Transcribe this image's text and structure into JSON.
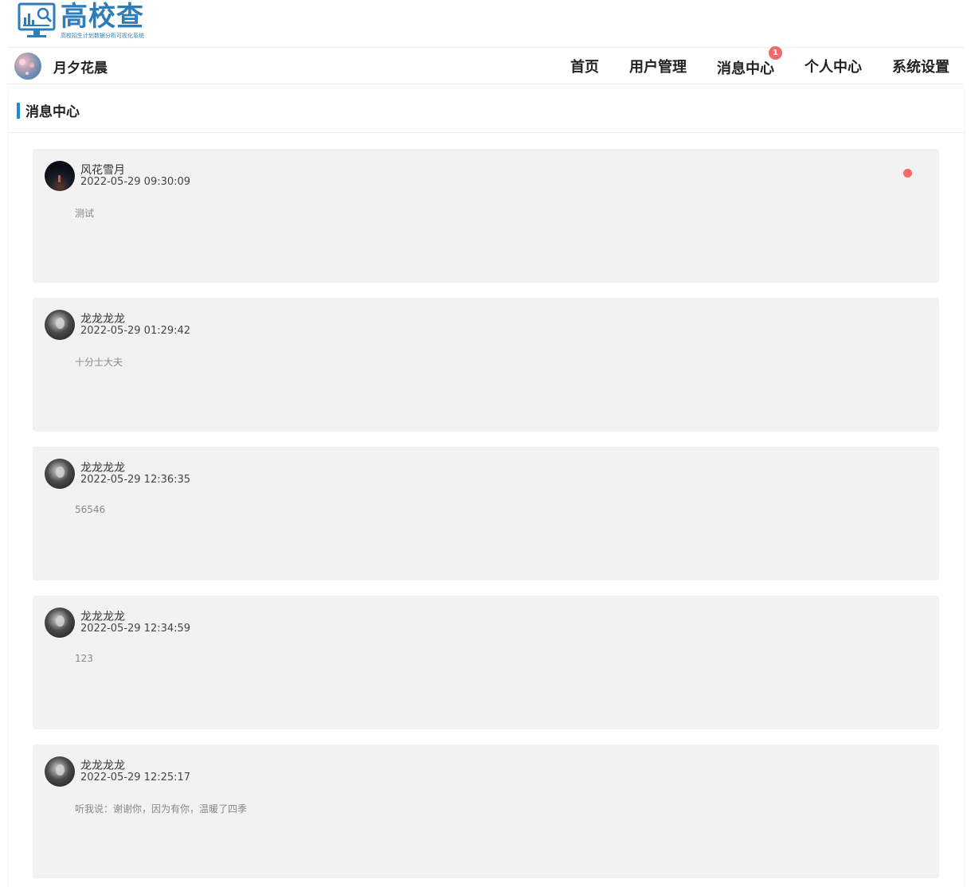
{
  "logo": {
    "title": "高校查",
    "subtitle": "高校招生计划数据分析可视化系统",
    "icon": "monitor-chart-search-icon",
    "color": "#2f7db8"
  },
  "user": {
    "name": "月夕花晨",
    "avatar": "user-avatar"
  },
  "nav": {
    "home": "首页",
    "user_management": "用户管理",
    "message_center": "消息中心",
    "message_badge": "1",
    "personal_center": "个人中心",
    "system_settings": "系统设置"
  },
  "panel": {
    "title": "消息中心",
    "accent": "#1e88d1"
  },
  "messages": [
    {
      "sender": "风花雪月",
      "time": "2022-05-29 09:30:09",
      "content": "测试",
      "unread": true
    },
    {
      "sender": "龙龙龙龙",
      "time": "2022-05-29 01:29:42",
      "content": "十分士大夫",
      "unread": false
    },
    {
      "sender": "龙龙龙龙",
      "time": "2022-05-29 12:36:35",
      "content": "56546",
      "unread": false
    },
    {
      "sender": "龙龙龙龙",
      "time": "2022-05-29 12:34:59",
      "content": "123",
      "unread": false
    },
    {
      "sender": "龙龙龙龙",
      "time": "2022-05-29 12:25:17",
      "content": "听我说：谢谢你，因为有你，温暖了四季",
      "unread": false
    }
  ],
  "colors": {
    "badge": "#f06a6a",
    "card_bg": "#f2f2f2"
  }
}
